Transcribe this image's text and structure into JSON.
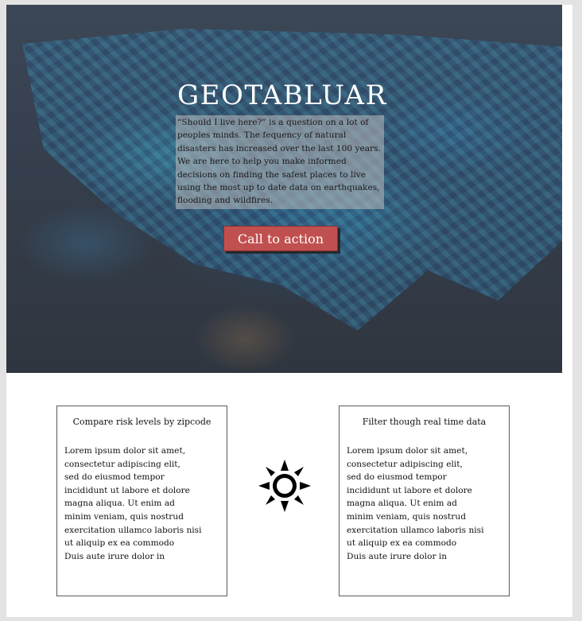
{
  "hero": {
    "title": "GEOTABLUAR",
    "description": "“Should I live here?” is a question on a lot of peoples minds. The fequency of natural disasters has increased over the last 100 years. We are here to help you make informed decisions on finding the safest places to live using the most up to date data on earthquakes, flooding and wildfires.",
    "cta_label": "Call to action"
  },
  "features": [
    {
      "title": "Compare risk levels by zipcode",
      "body": "Lorem ipsum dolor sit amet,\n consectetur adipiscing elit,\nsed do eiusmod tempor\n incididunt ut labore et dolore\n magna aliqua. Ut enim ad\nminim veniam, quis nostrud\nexercitation ullamco laboris nisi\nut aliquip ex ea commodo\n Duis aute irure dolor in"
    },
    {
      "title": "Filter though real time data",
      "body": "Lorem ipsum dolor sit amet,\n consectetur adipiscing elit,\nsed do eiusmod tempor\n incididunt ut labore et dolore\n magna aliqua. Ut enim ad\nminim veniam, quis nostrud\nexercitation ullamco laboris nisi\nut aliquip ex ea commodo\n Duis aute irure dolor in"
    }
  ],
  "icons": {
    "center": "sun-icon",
    "background": "us-map-image"
  },
  "colors": {
    "cta_background": "#c0504f",
    "hero_overlay": "#353e4c",
    "card_border": "#5a5a5a"
  }
}
